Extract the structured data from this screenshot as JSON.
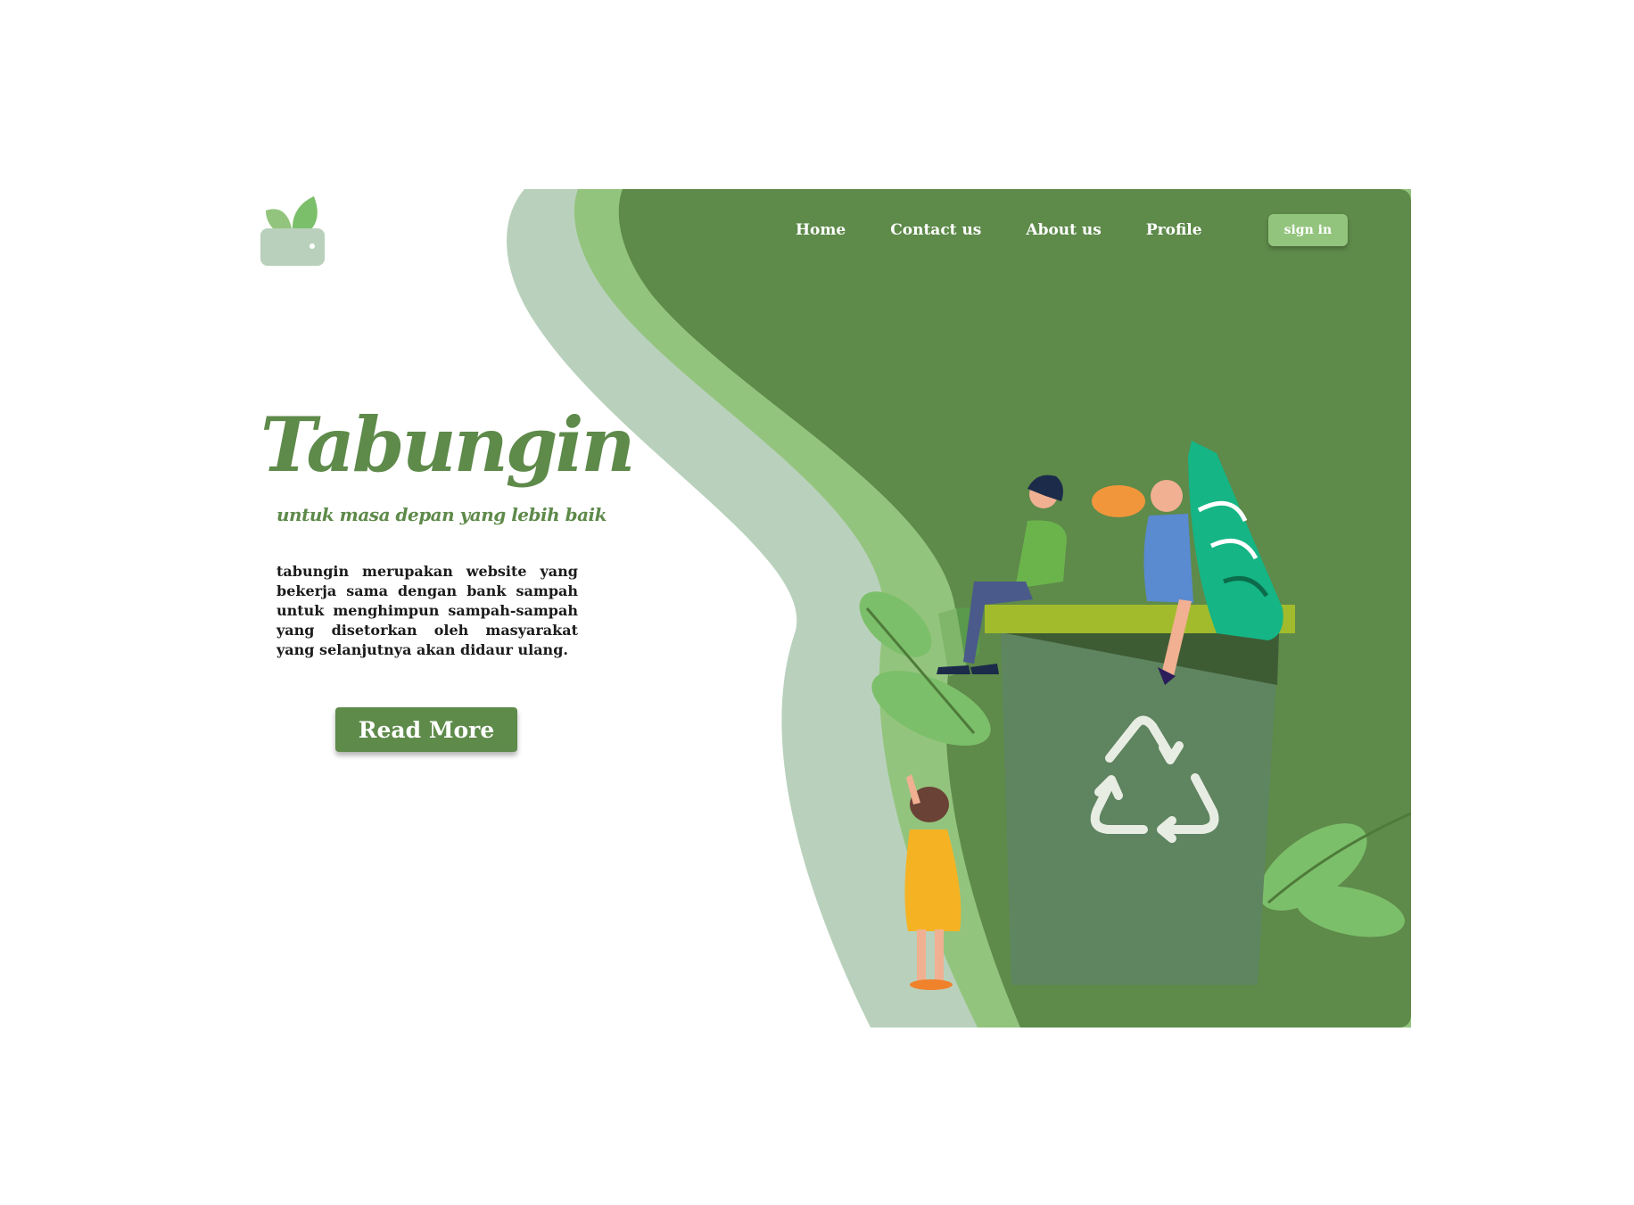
{
  "colors": {
    "primary": "#5e8a4a",
    "hero_bg": "#5e8a4a",
    "light_green": "#93c47d",
    "pale_green": "#b9d1bc",
    "bin": "#5f8460",
    "bin_lid": "#a2bb2c",
    "bottle": "#15b585"
  },
  "logo": {
    "icon": "leaf-wallet-icon"
  },
  "nav": {
    "items": [
      {
        "label": "Home"
      },
      {
        "label": "Contact us"
      },
      {
        "label": "About us"
      },
      {
        "label": "Profile"
      }
    ],
    "signin_label": "sign in"
  },
  "hero": {
    "title": "Tabungin",
    "tagline": "untuk masa depan yang lebih baik",
    "description": "tabungin merupakan website yang bekerja sama dengan bank sampah untuk menghimpun sampah-sampah yang disetorkan oleh masyarakat yang selanjutnya akan didaur ulang.",
    "read_more_label": "Read More",
    "illustration": "recycle-bin-illustration",
    "recycle_icon": "recycle-icon"
  }
}
